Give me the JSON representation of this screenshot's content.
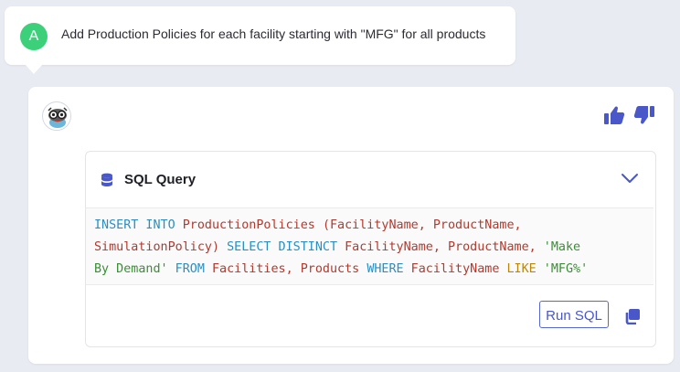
{
  "user_message": {
    "avatar_letter": "A",
    "text": "Add Production Policies for each facility starting with \"MFG\" for all products"
  },
  "assistant": {
    "avatar_icon": "bot-avatar-icon",
    "feedback": {
      "up_icon": "thumbs-up-icon",
      "down_icon": "thumbs-down-icon"
    },
    "sql_card": {
      "title": "SQL Query",
      "query": {
        "t1": "INSERT INTO",
        "t2": " ProductionPolicies ",
        "t3": "(",
        "t4": "FacilityName, ProductName,",
        "t5": "SimulationPolicy",
        "t6": ")",
        "t7": " SELECT DISTINCT",
        "t8": " FacilityName, ProductName, ",
        "t9": "'Make",
        "t10": "By Demand'",
        "t11": " FROM",
        "t12": " Facilities, Products ",
        "t13": "WHERE",
        "t14": " FacilityName ",
        "t15": "LIKE",
        "t16": " 'MFG%'"
      },
      "run_label": "Run SQL"
    }
  },
  "colors": {
    "accent": "#4a57c9",
    "keyword": "#2a8fc0",
    "identifier": "#b03a2e",
    "string": "#3a8e34",
    "avatar_user": "#3dd07a"
  }
}
